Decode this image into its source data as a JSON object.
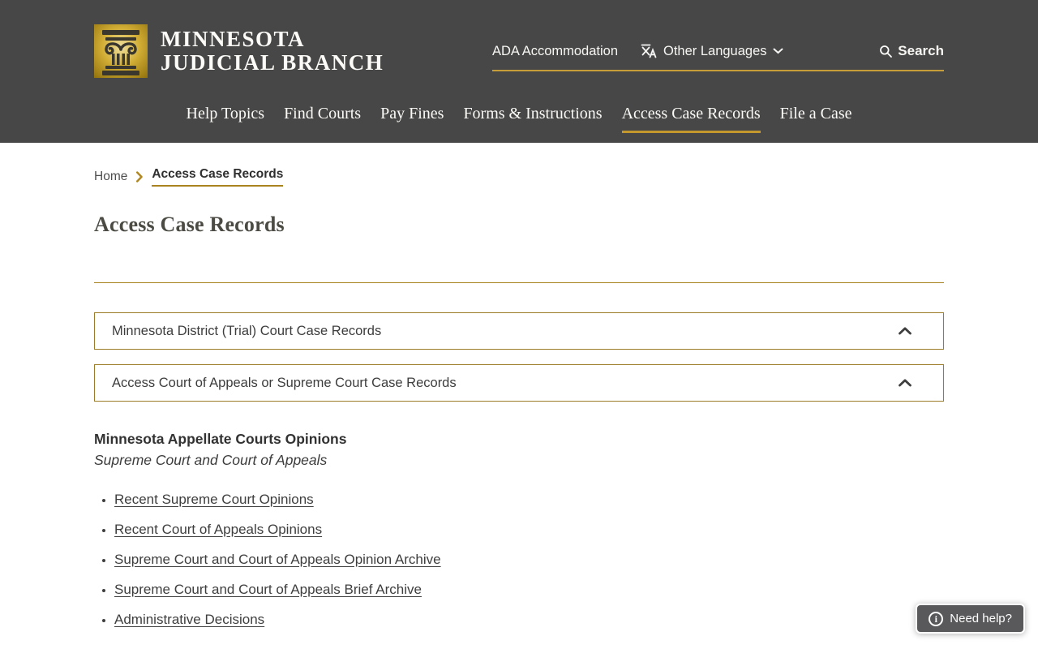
{
  "header": {
    "logo": {
      "line1": "Minnesota",
      "line2": "Judicial Branch"
    },
    "utility": {
      "ada_label": "ADA Accommodation",
      "languages_label": "Other Languages",
      "search_label": "Search"
    },
    "nav": [
      {
        "label": "Help Topics",
        "active": false
      },
      {
        "label": "Find Courts",
        "active": false
      },
      {
        "label": "Pay Fines",
        "active": false
      },
      {
        "label": "Forms & Instructions",
        "active": false
      },
      {
        "label": "Access Case Records",
        "active": true
      },
      {
        "label": "File a Case",
        "active": false
      }
    ]
  },
  "breadcrumb": {
    "home": "Home",
    "current": "Access Case Records"
  },
  "page": {
    "title": "Access Case Records"
  },
  "accordions": [
    {
      "label": "Minnesota District (Trial) Court Case Records",
      "state": "expanded"
    },
    {
      "label": "Access Court of Appeals or Supreme Court Case Records",
      "state": "expanded"
    }
  ],
  "opinions": {
    "heading": "Minnesota Appellate Courts Opinions",
    "subheading": "Supreme Court and Court of Appeals",
    "links": [
      "Recent Supreme Court Opinions",
      "Recent Court of Appeals Opinions",
      "Supreme Court and Court of Appeals Opinion Archive",
      "Supreme Court and Court of Appeals Brief Archive",
      "Administrative Decisions"
    ]
  },
  "help_button": {
    "label": "Need help?"
  },
  "colors": {
    "header_background": "#474747",
    "gold_accent": "#c59e3a",
    "dark_gold_rule": "#a6831c",
    "accordion_border": "#9c7c26",
    "text_dark": "#3e3e3e",
    "help_button_background": "#59595b"
  }
}
